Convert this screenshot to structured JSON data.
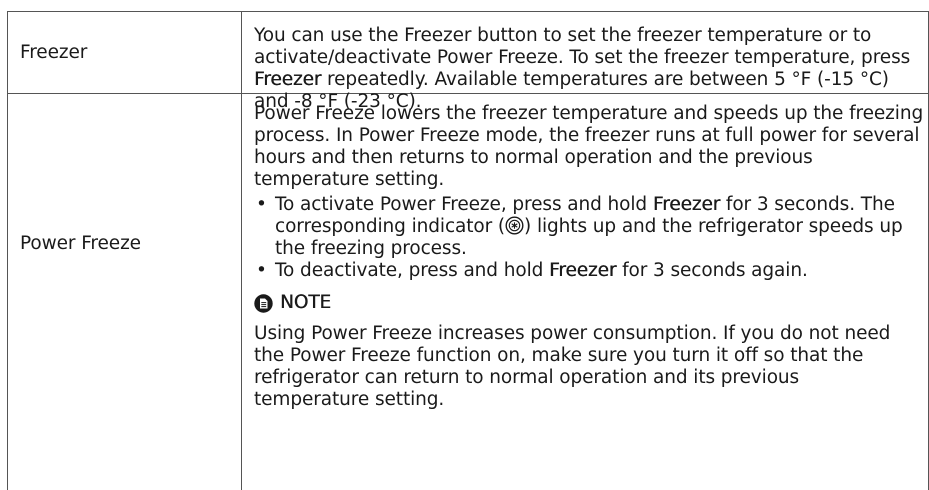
{
  "rows": [
    {
      "label": "Freezer",
      "desc_parts": [
        "You can use the Freezer button to set the freezer temperature or to activate/deactivate Power Freeze. To set the freezer temperature, press ",
        "Freezer",
        " repeatedly. Available temperatures are between 5 °F (-15 °C) and -8 °F (-23 °C)."
      ]
    },
    {
      "label": "Power Freeze",
      "intro": "Power Freeze lowers the freezer temperature and speeds up the freezing process. In Power Freeze mode, the freezer runs at full power for several hours and then returns to normal operation and the previous temperature setting.",
      "bullets": [
        {
          "pre": "To activate Power Freeze, press and hold ",
          "bold": "Freezer",
          "mid": " for 3 seconds. The corresponding indicator (",
          "icon": "power-freeze-indicator-icon",
          "post": ") lights up and the refrigerator speeds up the freezing process."
        },
        {
          "pre": "To deactivate, press and hold ",
          "bold": "Freezer",
          "post": " for 3 seconds again."
        }
      ],
      "note_title": "NOTE",
      "note_icon": "note-icon",
      "note_body": "Using Power Freeze increases power consumption. If you do not need the Power Freeze function on, make sure you turn it off so that the refrigerator can return to normal operation and its previous temperature setting."
    }
  ],
  "colors": {
    "text": "#1a1a1a",
    "border": "#555555"
  }
}
